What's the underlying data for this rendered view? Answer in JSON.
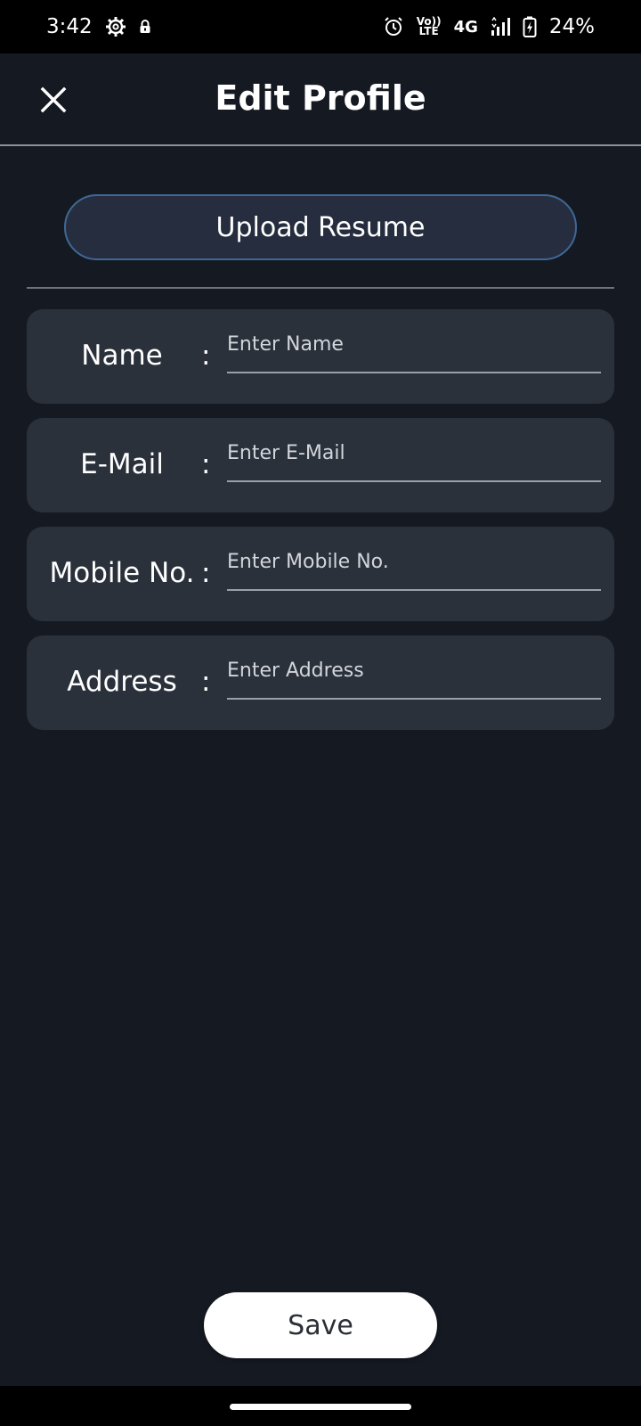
{
  "status_bar": {
    "time": "3:42",
    "volte_top": "Vo))",
    "volte_bottom": "LTE",
    "network": "4G",
    "battery": "24%"
  },
  "header": {
    "title": "Edit Profile"
  },
  "upload": {
    "label": "Upload Resume"
  },
  "form": {
    "fields": [
      {
        "label": "Name",
        "placeholder": "Enter Name",
        "value": ""
      },
      {
        "label": "E-Mail",
        "placeholder": "Enter E-Mail",
        "value": ""
      },
      {
        "label": "Mobile No.",
        "placeholder": "Enter Mobile No.",
        "value": ""
      },
      {
        "label": "Address",
        "placeholder": "Enter Address",
        "value": ""
      }
    ],
    "separator": ":"
  },
  "actions": {
    "save_label": "Save"
  },
  "colors": {
    "background": "#151a22",
    "card": "#2a313b",
    "upload_bg": "#262d3e",
    "upload_border": "#3f6897"
  }
}
